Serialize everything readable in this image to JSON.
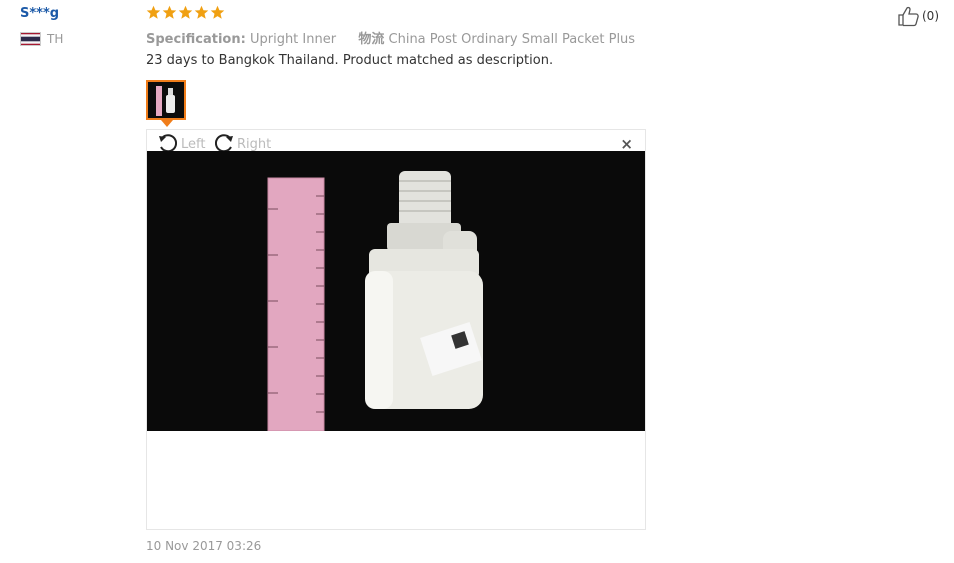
{
  "reviewer": {
    "name": "S***g",
    "country": "TH"
  },
  "rating": {
    "stars": 5,
    "max": 5,
    "color": "#f0a012"
  },
  "spec": {
    "label": "Specification:",
    "value": "Upright Inner",
    "shipping_label": "物流",
    "shipping_value": "China Post Ordinary Small Packet Plus"
  },
  "review": {
    "text": "23 days to Bangkok Thailand. Product matched as description."
  },
  "viewer": {
    "rotate_left": "Left",
    "rotate_right": "Right",
    "close": "×"
  },
  "date": "10 Nov 2017 03:26",
  "helpful": {
    "count": "(0)"
  },
  "colors": {
    "accent": "#f07d1a",
    "link": "#1c5aa8"
  }
}
